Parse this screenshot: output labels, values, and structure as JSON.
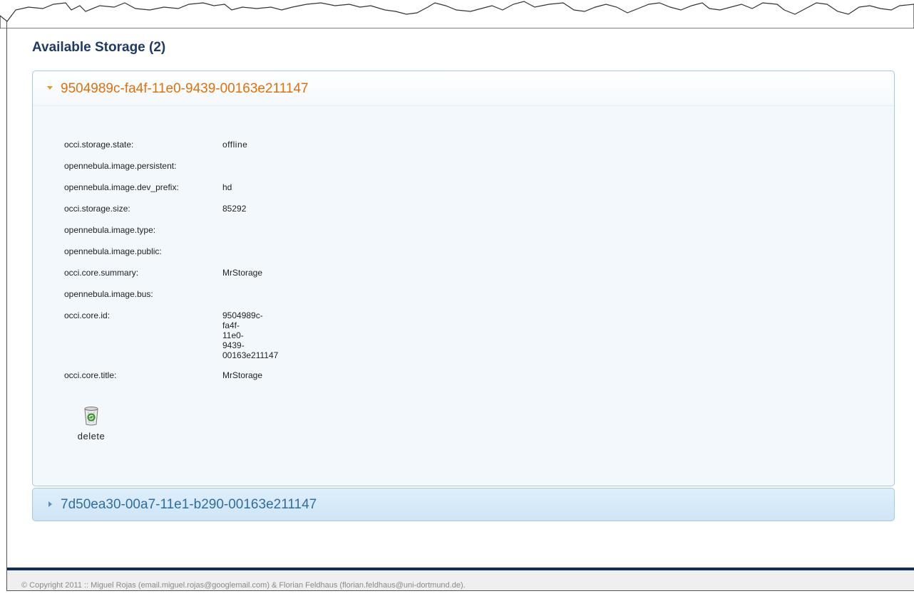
{
  "section": {
    "title": "Available Storage (2)"
  },
  "storages": [
    {
      "id": "9504989c-fa4f-11e0-9439-00163e211147",
      "expanded": true,
      "properties": [
        {
          "key": "occi.storage.state:",
          "value": "offline"
        },
        {
          "key": "opennebula.image.persistent:",
          "value": ""
        },
        {
          "key": "opennebula.image.dev_prefix:",
          "value": "hd"
        },
        {
          "key": "occi.storage.size:",
          "value": "85292"
        },
        {
          "key": "opennebula.image.type:",
          "value": ""
        },
        {
          "key": "opennebula.image.public:",
          "value": ""
        },
        {
          "key": "occi.core.summary:",
          "value": "MrStorage"
        },
        {
          "key": "opennebula.image.bus:",
          "value": ""
        },
        {
          "key": "occi.core.id:",
          "value": "9504989c-fa4f-11e0-9439-00163e211147"
        },
        {
          "key": "occi.core.title:",
          "value": "MrStorage"
        }
      ],
      "delete_label": "delete"
    },
    {
      "id": "7d50ea30-00a7-11e1-b290-00163e211147",
      "expanded": false
    }
  ],
  "footer": {
    "text": "© Copyright 2011 :: Miguel Rojas (email.miguel.rojas@googlemail.com) & Florian Feldhaus (florian.feldhaus@uni-dortmund.de)."
  },
  "colors": {
    "title": "#1f3a68",
    "active_header": "#e17009",
    "inactive_header": "#2e6e9e",
    "panel_border": "#a6c9e2",
    "footer_bar": "#0e2e5c"
  },
  "icons": {
    "expanded_arrow": "triangle-down-icon",
    "collapsed_arrow": "triangle-right-icon",
    "delete": "trash-icon"
  }
}
